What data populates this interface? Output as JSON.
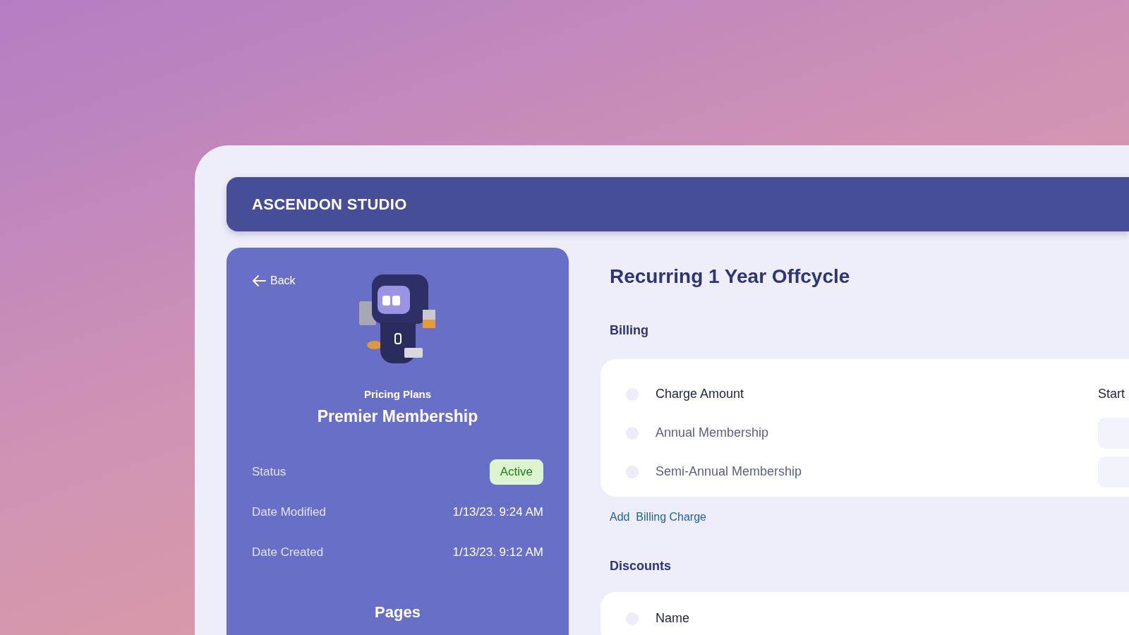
{
  "header": {
    "brand": "ASCENDON STUDIO"
  },
  "plan_panel": {
    "back": "Back",
    "category": "Pricing Plans",
    "name": "Premier Membership",
    "details": [
      {
        "kind": "badge",
        "label": "Status",
        "value": "Active"
      },
      {
        "kind": "text",
        "label": "Date Modified",
        "value": "1/13/23. 9:24 AM"
      },
      {
        "kind": "text",
        "label": "Date Created",
        "value": "1/13/23. 9:12 AM"
      }
    ],
    "pages_heading": "Pages"
  },
  "title": "Recurring 1 Year Offcycle",
  "billing": {
    "heading": "Billing",
    "columns": [
      "Charge Amount",
      "Start"
    ],
    "header_selected": false,
    "rows": [
      {
        "name": "Annual Membership",
        "selected": false
      },
      {
        "name": "Semi-Annual Membership",
        "selected": false
      }
    ],
    "add_link": "Add  Billing Charge"
  },
  "discounts": {
    "heading": "Discounts",
    "columns": [
      "Name"
    ],
    "header_selected": false
  }
}
